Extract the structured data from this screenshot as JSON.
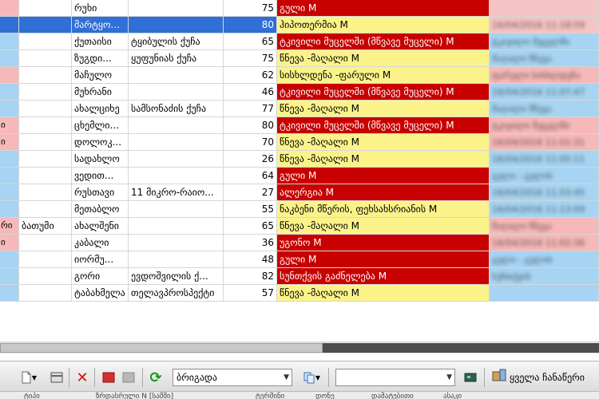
{
  "grid": {
    "rows": [
      {
        "c0": "",
        "c1": "",
        "c2": "რუხი",
        "c3": "",
        "c4": "75",
        "c5": "გული M",
        "c6": "",
        "c0color": "#f6b8b8",
        "c5bg": "#c80000",
        "c5fg": "#ffffff",
        "c6bg": "#f5c4c4"
      },
      {
        "c0": "",
        "c1": "",
        "c2": "მარტყო...",
        "c3": "",
        "c4": "80",
        "c5": "ჰიპოთერმია M",
        "c6": "16/04/2016 11:18:59",
        "c0color": "#2f6fd6",
        "c5bg": "#fbf38a",
        "c5fg": "#000000",
        "c6bg": "#f5c4c4",
        "selected": true
      },
      {
        "c0": "",
        "c1": "",
        "c2": "ქუთაისი",
        "c3": "ტყიბულის ქუჩა",
        "c4": "65",
        "c5": "ტკივილი მუცელში (მწვავე მუცელი) M",
        "c6": "ტკივილი მუცელში",
        "c0color": "#a6d4f2",
        "c5bg": "#c80000",
        "c5fg": "#ffffff",
        "c6bg": "#a6d4f2"
      },
      {
        "c0": "",
        "c1": "",
        "c2": "ზუგდი...",
        "c3": "ყუფუნიას ქუჩა",
        "c4": "75",
        "c5": "წნევა -მაღალი M",
        "c6": "მაღალი წნევა",
        "c0color": "#a6d4f2",
        "c5bg": "#fbf38a",
        "c5fg": "#000000",
        "c6bg": "#a6d4f2"
      },
      {
        "c0": "",
        "c1": "",
        "c2": "მაჩულო",
        "c3": "",
        "c4": "62",
        "c5": "სისხლდენა -ფარული M",
        "c6": "ფარული სისხლდენა",
        "c0color": "#f6b8b8",
        "c5bg": "#fbf38a",
        "c5fg": "#000000",
        "c6bg": "#f6b8b8"
      },
      {
        "c0": "",
        "c1": "",
        "c2": "მუხრანი",
        "c3": "",
        "c4": "46",
        "c5": "ტკივილი მუცელში (მწვავე მუცელი) M",
        "c6": "16/04/2016 11:07:47",
        "c0color": "#a6d4f2",
        "c5bg": "#c80000",
        "c5fg": "#ffffff",
        "c6bg": "#a6d4f2"
      },
      {
        "c0": "",
        "c1": "",
        "c2": "ახალციხე",
        "c3": "სამსონაძის ქუჩა",
        "c4": "77",
        "c5": "წნევა -მაღალი M",
        "c6": "მაღალი წნევა",
        "c0color": "#a6d4f2",
        "c5bg": "#fbf38a",
        "c5fg": "#000000",
        "c6bg": "#a6d4f2"
      },
      {
        "c0": "ი",
        "c1": "",
        "c2": "ცხემლი...",
        "c3": "",
        "c4": "80",
        "c5": "ტკივილი მუცელში (მწვავე მუცელი) M",
        "c6": "ტკივილი მუცელში",
        "c0color": "#f6b8b8",
        "c5bg": "#c80000",
        "c5fg": "#ffffff",
        "c6bg": "#f6b8b8"
      },
      {
        "c0": "ი",
        "c1": "",
        "c2": "დოლოკ...",
        "c3": "",
        "c4": "70",
        "c5": "წნევა -მაღალი M",
        "c6": "16/04/2016 11:01:31",
        "c0color": "#f6b8b8",
        "c5bg": "#fbf38a",
        "c5fg": "#000000",
        "c6bg": "#f6b8b8"
      },
      {
        "c0": "",
        "c1": "",
        "c2": "სადახლო",
        "c3": "",
        "c4": "26",
        "c5": "წნევა -მაღალი M",
        "c6": "16/04/2016 11:05:11",
        "c0color": "#a6d4f2",
        "c5bg": "#fbf38a",
        "c5fg": "#000000",
        "c6bg": "#a6d4f2"
      },
      {
        "c0": "",
        "c1": "",
        "c2": "ვედით...",
        "c3": "",
        "c4": "64",
        "c5": "გული M",
        "c6": "გული - გულის",
        "c0color": "#a6d4f2",
        "c5bg": "#c80000",
        "c5fg": "#ffffff",
        "c6bg": "#a6d4f2"
      },
      {
        "c0": "",
        "c1": "",
        "c2": "რუსთავი",
        "c3": "11 მიკრო-რაიო...",
        "c4": "27",
        "c5": "ალერგია M",
        "c6": "16/04/2016 11:03:45",
        "c0color": "#a6d4f2",
        "c5bg": "#c80000",
        "c5fg": "#ffffff",
        "c6bg": "#a6d4f2"
      },
      {
        "c0": "",
        "c1": "",
        "c2": "მეთაბლო",
        "c3": "",
        "c4": "55",
        "c5": "ნაკბენი მწერის, ფეხსახსრიანის M",
        "c6": "16/04/2016 11:13:09",
        "c0color": "#a6d4f2",
        "c5bg": "#fbf38a",
        "c5fg": "#000000",
        "c6bg": "#a6d4f2"
      },
      {
        "c0": "რი",
        "c1": "ბათუმი",
        "c2": "ახალშენი",
        "c3": "",
        "c4": "65",
        "c5": "წნევა -მაღალი M",
        "c6": "მაღალი წნევა",
        "c0color": "#f6b8b8",
        "c5bg": "#fbf38a",
        "c5fg": "#000000",
        "c6bg": "#f6b8b8"
      },
      {
        "c0": "ი",
        "c1": "",
        "c2": "კაბალი",
        "c3": "",
        "c4": "36",
        "c5": "უგონო M",
        "c6": "16/04/2016 11:02:36",
        "c0color": "#f6b8b8",
        "c5bg": "#c80000",
        "c5fg": "#ffffff",
        "c6bg": "#f6b8b8"
      },
      {
        "c0": "",
        "c1": "",
        "c2": "იორმუ...",
        "c3": "",
        "c4": "48",
        "c5": "გული M",
        "c6": "გული - გულის",
        "c0color": "#a6d4f2",
        "c5bg": "#c80000",
        "c5fg": "#ffffff",
        "c6bg": "#a6d4f2"
      },
      {
        "c0": "",
        "c1": "",
        "c2": "გორი",
        "c3": "ევდოშვილის ქ...",
        "c4": "82",
        "c5": "სუნთქვის გაძნელება M",
        "c6": "სუნთქვის",
        "c0color": "#a6d4f2",
        "c5bg": "#c80000",
        "c5fg": "#ffffff",
        "c6bg": "#a6d4f2"
      },
      {
        "c0": "",
        "c1": "",
        "c2": "ტაბახმელა",
        "c3": "თელავპროსპექტი",
        "c4": "57",
        "c5": "წნევა -მაღალი M",
        "c6": "",
        "c0color": "#a6d4f2",
        "c5bg": "#fbf38a",
        "c5fg": "#000000",
        "c6bg": "#a6d4f2"
      }
    ]
  },
  "toolbar": {
    "brigade_label": "ბრიგადა",
    "empty_dropdown_value": "",
    "all_stations_label": "ყველა ჩანაწერი"
  },
  "bottom_header": [
    "ტიპი",
    "ზრდასრული N [სამში]",
    "ტერმინი",
    "დონე",
    "დამატებითი",
    "ასაკი"
  ]
}
